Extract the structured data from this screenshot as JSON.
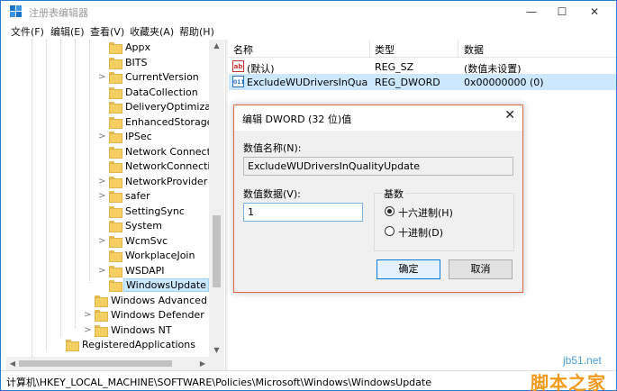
{
  "window": {
    "title": "注册表编辑器",
    "minimize": "—",
    "maximize": "☐",
    "close": "✕"
  },
  "menu": [
    "文件(F)",
    "编辑(E)",
    "查看(V)",
    "收藏夹(A)",
    "帮助(H)"
  ],
  "tree": {
    "items": [
      {
        "label": "Appx",
        "expandable": false
      },
      {
        "label": "BITS",
        "expandable": false
      },
      {
        "label": "CurrentVersion",
        "expandable": true
      },
      {
        "label": "DataCollection",
        "expandable": false
      },
      {
        "label": "DeliveryOptimization",
        "expandable": false
      },
      {
        "label": "EnhancedStorageDevices",
        "expandable": false
      },
      {
        "label": "IPSec",
        "expandable": true
      },
      {
        "label": "Network Connections",
        "expandable": false
      },
      {
        "label": "NetworkConnectivityStatusIndicator",
        "expandable": false
      },
      {
        "label": "NetworkProvider",
        "expandable": true
      },
      {
        "label": "safer",
        "expandable": true
      },
      {
        "label": "SettingSync",
        "expandable": false
      },
      {
        "label": "System",
        "expandable": false
      },
      {
        "label": "WcmSvc",
        "expandable": true
      },
      {
        "label": "WorkplaceJoin",
        "expandable": false
      },
      {
        "label": "WSDAPI",
        "expandable": true
      },
      {
        "label": "WindowsUpdate",
        "expandable": false,
        "selected": true
      },
      {
        "label": "Windows Advanced Threat Protection",
        "expandable": false
      },
      {
        "label": "Windows Defender",
        "expandable": true
      },
      {
        "label": "Windows NT",
        "expandable": true
      },
      {
        "label": "RegisteredApplications",
        "expandable": false
      }
    ]
  },
  "list": {
    "columns": [
      "名称",
      "类型",
      "数据"
    ],
    "rows": [
      {
        "icon": "ab",
        "name": "(默认)",
        "type": "REG_SZ",
        "data": "(数值未设置)"
      },
      {
        "icon": "011",
        "name": "ExcludeWUDriversInQualityUpdate",
        "type": "REG_DWORD",
        "data": "0x00000000 (0)",
        "selected": true
      }
    ]
  },
  "status": {
    "path": "计算机\\HKEY_LOCAL_MACHINE\\SOFTWARE\\Policies\\Microsoft\\Windows\\WindowsUpdate"
  },
  "dialog": {
    "title": "编辑 DWORD (32 位)值",
    "close": "✕",
    "name_label": "数值名称(N):",
    "name_value": "ExcludeWUDriversInQualityUpdate",
    "data_label": "数值数据(V):",
    "data_value": "1",
    "base_label": "基数",
    "hex_label": "十六进制(H)",
    "dec_label": "十进制(D)",
    "ok": "确定",
    "cancel": "取消"
  },
  "watermark": {
    "site": "jb51.net",
    "brand": "脚本之家"
  }
}
